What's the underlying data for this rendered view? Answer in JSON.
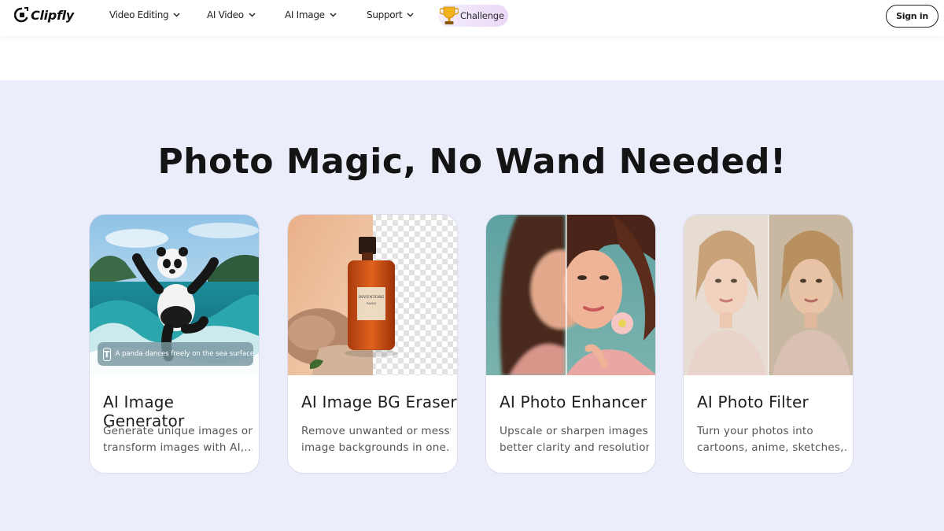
{
  "header": {
    "logo_text": "Clipfly",
    "nav": [
      {
        "label": "Video Editing"
      },
      {
        "label": "AI Video"
      },
      {
        "label": "AI Image"
      },
      {
        "label": "Support"
      }
    ],
    "challenge_label": "Challenge",
    "signin_label": "Sign in"
  },
  "main": {
    "headline": "Photo Magic, No Wand Needed!",
    "cards": [
      {
        "title": "AI Image Generator",
        "desc_line1": "Generate unique images or",
        "desc_line2": "transform images with AI,…",
        "prompt_text": "A panda dances freely on the sea surface",
        "prompt_icon": "T"
      },
      {
        "title": "AI Image BG Eraser",
        "desc_line1": "Remove unwanted or messy",
        "desc_line2": "image backgrounds in one…",
        "label_brand": "INVENTORE",
        "label_sub": "PARIS"
      },
      {
        "title": "AI Photo Enhancer",
        "desc_line1": "Upscale or sharpen images to",
        "desc_line2": "better clarity and resolution…"
      },
      {
        "title": "AI Photo Filter",
        "desc_line1": "Turn your photos into",
        "desc_line2": "cartoons, anime, sketches,…"
      }
    ]
  },
  "colors": {
    "section_bg": "#ecedfa",
    "challenge_bg": "#ead8f8"
  }
}
